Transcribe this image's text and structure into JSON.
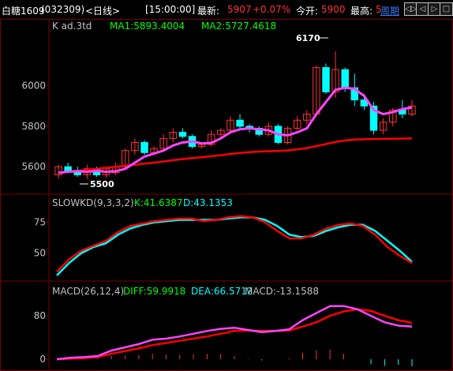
{
  "header": {
    "title": "白糖1609",
    "code": "(032309)",
    "period": "<日线>",
    "time": "[15:00:00]",
    "latest_label": "最新:",
    "latest_value": "5907",
    "change_pct": "+0.07%",
    "open_label": "今开:",
    "open_value": "5900",
    "high_label": "最高:",
    "high_value": "5",
    "cycle_label": "周期",
    "buttons": [
      "◁▷",
      "◁",
      "▷",
      "□"
    ]
  },
  "main_panel": {
    "title_prefix": "K  ad.3td",
    "ma1_label": "MA1:5893.4004",
    "ma2_label": "MA2:5727.4618",
    "y_ticks": [
      5600,
      5800,
      6000
    ],
    "ylim": [
      5480,
      6260
    ],
    "annotation_high": "6170",
    "annotation_low": "5500",
    "candles": [
      [
        5560,
        5600,
        5540,
        5610
      ],
      [
        5600,
        5580,
        5570,
        5620
      ],
      [
        5580,
        5560,
        5550,
        5600
      ],
      [
        5560,
        5590,
        5540,
        5610
      ],
      [
        5590,
        5560,
        5550,
        5600
      ],
      [
        5560,
        5590,
        5545,
        5600
      ],
      [
        5570,
        5600,
        5560,
        5620
      ],
      [
        5600,
        5680,
        5590,
        5690
      ],
      [
        5680,
        5720,
        5660,
        5740
      ],
      [
        5720,
        5670,
        5660,
        5730
      ],
      [
        5670,
        5690,
        5660,
        5700
      ],
      [
        5690,
        5740,
        5680,
        5760
      ],
      [
        5740,
        5770,
        5720,
        5790
      ],
      [
        5770,
        5750,
        5740,
        5790
      ],
      [
        5750,
        5700,
        5690,
        5760
      ],
      [
        5700,
        5710,
        5690,
        5720
      ],
      [
        5710,
        5760,
        5700,
        5780
      ],
      [
        5760,
        5780,
        5740,
        5790
      ],
      [
        5780,
        5830,
        5770,
        5850
      ],
      [
        5830,
        5800,
        5790,
        5860
      ],
      [
        5800,
        5790,
        5770,
        5810
      ],
      [
        5790,
        5760,
        5750,
        5800
      ],
      [
        5760,
        5800,
        5750,
        5820
      ],
      [
        5800,
        5720,
        5710,
        5810
      ],
      [
        5720,
        5790,
        5710,
        5800
      ],
      [
        5790,
        5830,
        5780,
        5850
      ],
      [
        5830,
        5860,
        5810,
        5880
      ],
      [
        5860,
        6090,
        5850,
        6100
      ],
      [
        6090,
        5970,
        5960,
        6110
      ],
      [
        5970,
        6080,
        5940,
        6170
      ],
      [
        6080,
        5990,
        5970,
        6090
      ],
      [
        5990,
        5930,
        5900,
        6060
      ],
      [
        5930,
        5900,
        5880,
        5960
      ],
      [
        5900,
        5780,
        5760,
        5920
      ],
      [
        5780,
        5820,
        5760,
        5840
      ],
      [
        5820,
        5880,
        5800,
        5890
      ],
      [
        5880,
        5860,
        5840,
        5930
      ],
      [
        5860,
        5900,
        5850,
        5930
      ]
    ],
    "ma1": [
      5570,
      5575,
      5578,
      5575,
      5580,
      5575,
      5578,
      5590,
      5620,
      5650,
      5665,
      5680,
      5705,
      5720,
      5725,
      5715,
      5718,
      5740,
      5770,
      5785,
      5790,
      5785,
      5780,
      5760,
      5755,
      5770,
      5790,
      5860,
      5920,
      5980,
      5990,
      5985,
      5950,
      5880,
      5860,
      5870,
      5885,
      5893
    ],
    "ma2": [
      5570,
      5575,
      5580,
      5585,
      5590,
      5595,
      5600,
      5605,
      5610,
      5615,
      5620,
      5626,
      5632,
      5638,
      5643,
      5647,
      5652,
      5657,
      5663,
      5668,
      5672,
      5675,
      5677,
      5678,
      5681,
      5686,
      5692,
      5702,
      5712,
      5722,
      5730,
      5734,
      5736,
      5737,
      5738,
      5738,
      5739,
      5740
    ]
  },
  "kd_panel": {
    "label": "SLOWKD(9,3,3,2)",
    "k_label": "K:41.6387",
    "d_label": "D:43.1353",
    "y_ticks": [
      50,
      75
    ],
    "ylim": [
      30,
      85
    ],
    "k": [
      35,
      45,
      52,
      56,
      60,
      67,
      72,
      74,
      76,
      77,
      78,
      78,
      76,
      77,
      79,
      80,
      79,
      75,
      68,
      62,
      62,
      65,
      70,
      73,
      74,
      72,
      65,
      55,
      48,
      42
    ],
    "d": [
      32,
      42,
      50,
      55,
      58,
      65,
      70,
      73,
      75,
      76,
      77,
      77,
      77,
      77,
      78,
      79,
      79,
      77,
      72,
      65,
      63,
      64,
      68,
      71,
      73,
      73,
      68,
      60,
      52,
      43
    ]
  },
  "macd_panel": {
    "label": "MACD(26,12,4)",
    "diff_label": "DIFF:59.9918",
    "dea_label": "DEA:66.5712",
    "macd_label": "MACD:-13.1588",
    "y_ticks": [
      0,
      80
    ],
    "ylim": [
      -10,
      115
    ],
    "diff": [
      0,
      3,
      4,
      6,
      16,
      22,
      28,
      36,
      38,
      42,
      47,
      52,
      56,
      58,
      54,
      50,
      52,
      55,
      72,
      85,
      98,
      98,
      92,
      80,
      68,
      62,
      60
    ],
    "dea": [
      0,
      1,
      2,
      4,
      10,
      15,
      20,
      26,
      30,
      34,
      38,
      42,
      47,
      52,
      53,
      52,
      52,
      53,
      60,
      68,
      80,
      88,
      92,
      89,
      80,
      72,
      67
    ],
    "macd": [
      0,
      2,
      2,
      2,
      6,
      7,
      8,
      10,
      8,
      8,
      9,
      10,
      9,
      6,
      1,
      -2,
      0,
      2,
      12,
      17,
      18,
      10,
      0,
      -9,
      -12,
      -10,
      -13
    ]
  },
  "colors": {
    "up": "#ff3232",
    "down": "#00ffff",
    "ma1": "#ff44ff",
    "ma2": "#ff0000",
    "ma1_seg": "#00ff00",
    "k_line": "#ff0000",
    "d_line": "#00ffff",
    "diff_line": "#ff44ff",
    "dea_line": "#ff0000",
    "signal_buy": "#ff6a00",
    "signal_sell": "#00c000",
    "axis": "#7a0000",
    "text": "#c0c0c0",
    "label_green": "#00ff00",
    "label_cyan": "#00ffff"
  }
}
